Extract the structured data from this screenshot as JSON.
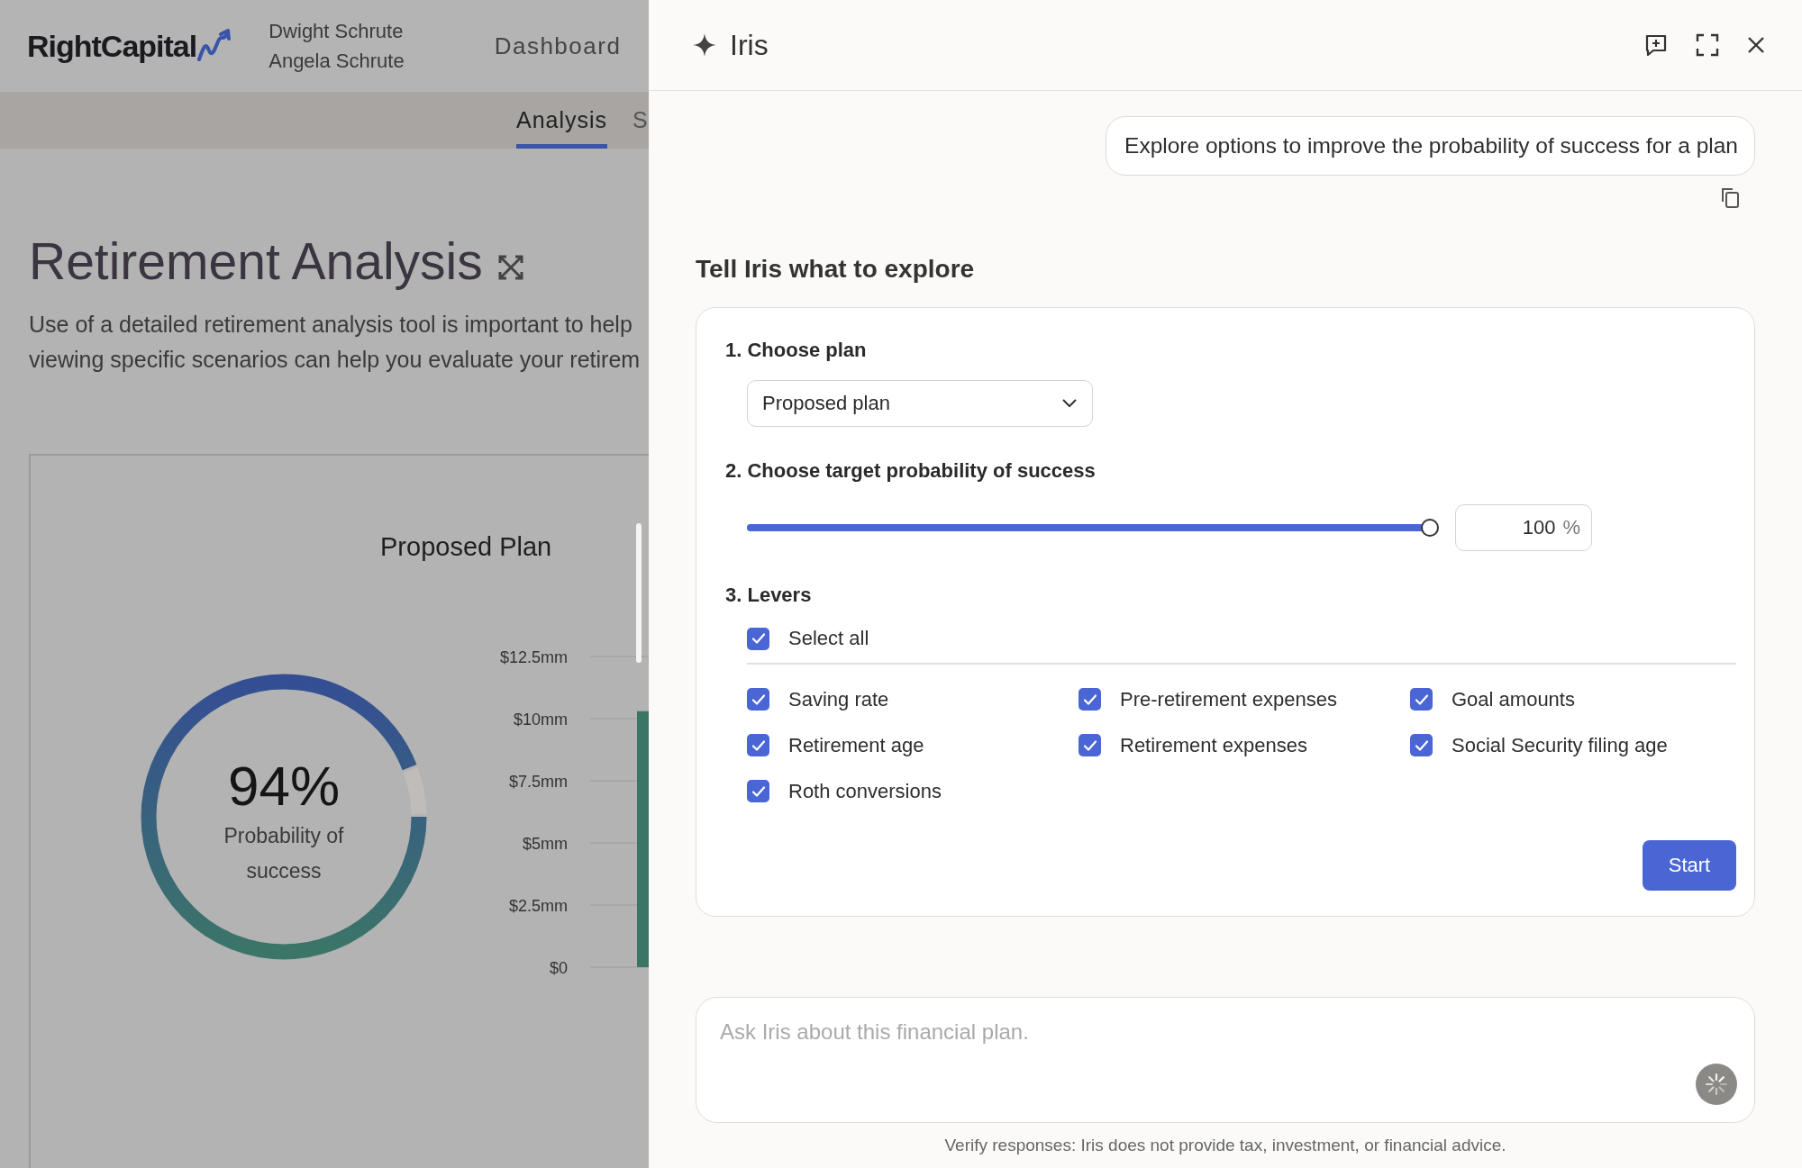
{
  "app_header": {
    "logo": "RightCapital",
    "clients": [
      "Dwight Schrute",
      "Angela Schrute"
    ],
    "nav": [
      "Dashboard"
    ]
  },
  "sub_nav": {
    "tabs": [
      {
        "label": "Analysis",
        "selected": true
      },
      {
        "label": "S",
        "selected": false
      }
    ]
  },
  "page": {
    "title": "Retirement Analysis",
    "description_lines": [
      "Use of a detailed retirement analysis tool is important to help",
      "viewing specific scenarios can help you evaluate your retirem"
    ]
  },
  "plan_card": {
    "title": "Proposed Plan",
    "gauge": {
      "value": "94%",
      "label": "Probability of success",
      "level": 0.94
    },
    "chart_data": {
      "type": "bar",
      "grid": true,
      "ylim": [
        0,
        12.5
      ],
      "yticks": [
        {
          "value": 0,
          "label": "$0"
        },
        {
          "value": 2.5,
          "label": "$2.5mm"
        },
        {
          "value": 5,
          "label": "$5mm"
        },
        {
          "value": 7.5,
          "label": "$7.5mm"
        },
        {
          "value": 10,
          "label": "$10mm"
        },
        {
          "value": 12.5,
          "label": "$12.5mm"
        }
      ],
      "series": [
        {
          "color": "#3b7566",
          "values": [
            10.3
          ]
        }
      ]
    }
  },
  "iris_panel": {
    "title": "Iris",
    "user_message": "Explore options to improve the probability of success for a plan",
    "form": {
      "heading": "Tell Iris what to explore",
      "plan_step": {
        "label": "1. Choose plan",
        "value": "Proposed plan"
      },
      "target_step": {
        "label": "2. Choose target probability of success",
        "level": 1.0,
        "value": "100",
        "unit": "%"
      },
      "levers_step": {
        "label": "3. Levers",
        "select_all": {
          "label": "Select all",
          "checked": true
        },
        "levers": [
          {
            "label": "Saving rate",
            "checked": true
          },
          {
            "label": "Pre-retirement expenses",
            "checked": true
          },
          {
            "label": "Goal amounts",
            "checked": true
          },
          {
            "label": "Retirement age",
            "checked": true
          },
          {
            "label": "Retirement expenses",
            "checked": true
          },
          {
            "label": "Social Security filing age",
            "checked": true
          },
          {
            "label": "Roth conversions",
            "checked": true
          }
        ]
      },
      "submit": "Start"
    },
    "chat": {
      "placeholder": "Ask Iris about this financial plan.",
      "disclaimer": "Verify responses: Iris does not provide tax, investment, or financial advice."
    }
  }
}
